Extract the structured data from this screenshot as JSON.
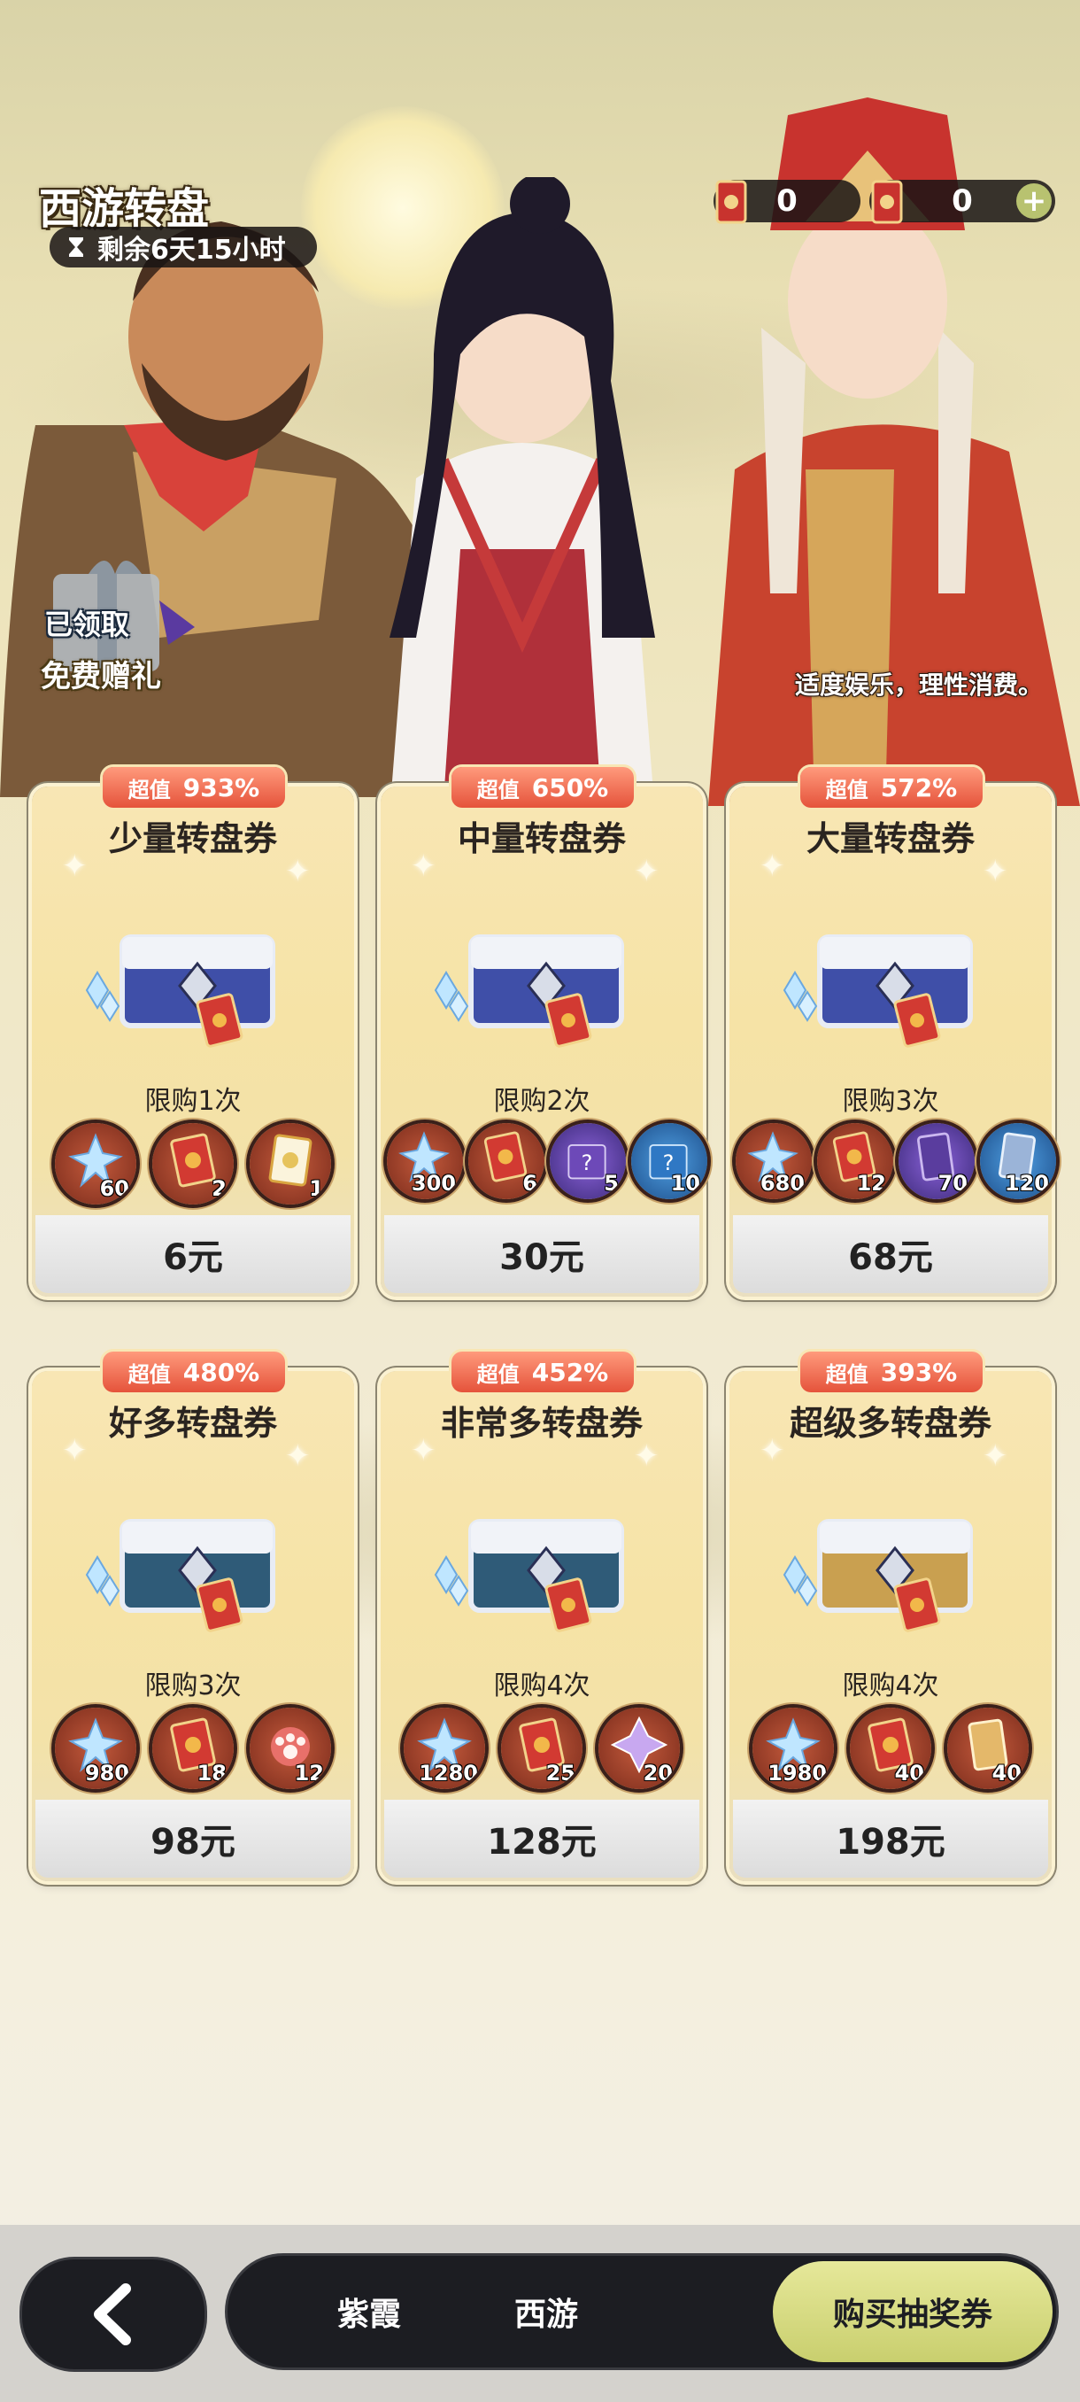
{
  "event": {
    "title": "西游转盘",
    "timer": "剩余6天15小时"
  },
  "currencies": [
    {
      "value": "0",
      "icon": "ticket-icon"
    },
    {
      "value": "0",
      "icon": "ticket-icon",
      "add": "+"
    }
  ],
  "gift": {
    "status": "已领取",
    "label": "免费赠礼"
  },
  "notice": "适度娱乐，理性消费。",
  "packs": [
    {
      "badge_label": "超值",
      "badge_value": "933%",
      "name": "少量转盘券",
      "limit": "限购1次",
      "items": [
        {
          "icon": "crystal-icon",
          "count": "60"
        },
        {
          "icon": "ticket-icon",
          "count": "2"
        },
        {
          "icon": "golden-ticket-icon",
          "count": "1"
        }
      ],
      "price": "6元"
    },
    {
      "badge_label": "超值",
      "badge_value": "650%",
      "name": "中量转盘券",
      "limit": "限购2次",
      "items": [
        {
          "icon": "crystal-icon",
          "count": "300"
        },
        {
          "icon": "ticket-icon",
          "count": "6"
        },
        {
          "icon": "mystery-box-purple-icon",
          "count": "5"
        },
        {
          "icon": "mystery-box-blue-icon",
          "count": "10"
        }
      ],
      "price": "30元"
    },
    {
      "badge_label": "超值",
      "badge_value": "572%",
      "name": "大量转盘券",
      "limit": "限购3次",
      "items": [
        {
          "icon": "crystal-icon",
          "count": "680"
        },
        {
          "icon": "ticket-icon",
          "count": "12"
        },
        {
          "icon": "purple-card-icon",
          "count": "70"
        },
        {
          "icon": "blue-card-icon",
          "count": "120"
        }
      ],
      "price": "68元"
    },
    {
      "badge_label": "超值",
      "badge_value": "480%",
      "name": "好多转盘券",
      "limit": "限购3次",
      "items": [
        {
          "icon": "crystal-icon",
          "count": "980"
        },
        {
          "icon": "ticket-icon",
          "count": "18"
        },
        {
          "icon": "paw-token-icon",
          "count": "12"
        }
      ],
      "price": "98元"
    },
    {
      "badge_label": "超值",
      "badge_value": "452%",
      "name": "非常多转盘券",
      "limit": "限购4次",
      "items": [
        {
          "icon": "crystal-icon",
          "count": "1280"
        },
        {
          "icon": "ticket-icon",
          "count": "25"
        },
        {
          "icon": "star-crystal-icon",
          "count": "20"
        }
      ],
      "price": "128元"
    },
    {
      "badge_label": "超值",
      "badge_value": "393%",
      "name": "超级多转盘券",
      "limit": "限购4次",
      "items": [
        {
          "icon": "crystal-icon",
          "count": "1980"
        },
        {
          "icon": "ticket-icon",
          "count": "40"
        },
        {
          "icon": "golden-card-icon",
          "count": "40"
        }
      ],
      "price": "198元"
    }
  ],
  "bottom": {
    "tabs": [
      "紫霞",
      "西游",
      "购买抽奖券"
    ]
  },
  "colors": {
    "badge": "#e5533b",
    "active_tab": "#d6db84",
    "bar": "#1c1d22"
  }
}
